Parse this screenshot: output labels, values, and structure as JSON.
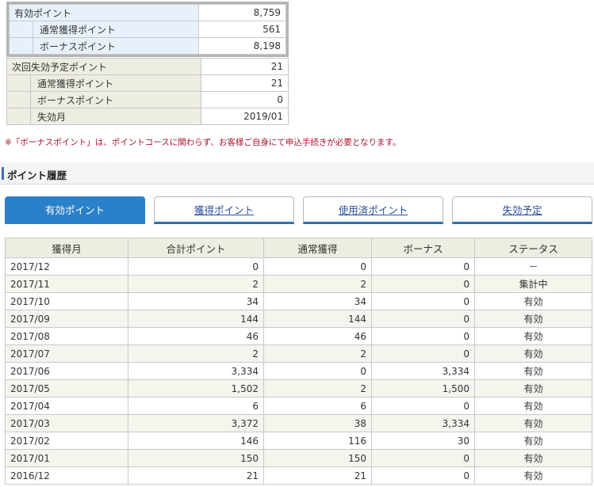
{
  "summary_valid": {
    "total": {
      "label": "有効ポイント",
      "value": "8,759"
    },
    "rows": [
      {
        "label": "通常獲得ポイント",
        "value": "561"
      },
      {
        "label": "ボーナスポイント",
        "value": "8,198"
      }
    ]
  },
  "summary_expire": {
    "total": {
      "label": "次回失効予定ポイント",
      "value": "21"
    },
    "rows": [
      {
        "label": "通常獲得ポイント",
        "value": "21"
      },
      {
        "label": "ボーナスポイント",
        "value": "0"
      },
      {
        "label": "失効月",
        "value": "2019/01"
      }
    ]
  },
  "note": "※「ボーナスポイント」は、ポイントコースに関わらず、お客様ご自身にて申込手続きが必要となります。",
  "section_title": "ポイント履歴",
  "tabs": [
    {
      "label": "有効ポイント",
      "active": true
    },
    {
      "label": "獲得ポイント",
      "active": false
    },
    {
      "label": "使用済ポイント",
      "active": false
    },
    {
      "label": "失効予定",
      "active": false
    }
  ],
  "history": {
    "headers": [
      "獲得月",
      "合計ポイント",
      "通常獲得",
      "ボーナス",
      "ステータス"
    ],
    "rows": [
      [
        "2017/12",
        "0",
        "0",
        "0",
        "－"
      ],
      [
        "2017/11",
        "2",
        "2",
        "0",
        "集計中"
      ],
      [
        "2017/10",
        "34",
        "34",
        "0",
        "有効"
      ],
      [
        "2017/09",
        "144",
        "144",
        "0",
        "有効"
      ],
      [
        "2017/08",
        "46",
        "46",
        "0",
        "有効"
      ],
      [
        "2017/07",
        "2",
        "2",
        "0",
        "有効"
      ],
      [
        "2017/06",
        "3,334",
        "0",
        "3,334",
        "有効"
      ],
      [
        "2017/05",
        "1,502",
        "2",
        "1,500",
        "有効"
      ],
      [
        "2017/04",
        "6",
        "6",
        "0",
        "有効"
      ],
      [
        "2017/03",
        "3,372",
        "38",
        "3,334",
        "有効"
      ],
      [
        "2017/02",
        "146",
        "116",
        "30",
        "有効"
      ],
      [
        "2017/01",
        "150",
        "150",
        "0",
        "有効"
      ],
      [
        "2016/12",
        "21",
        "21",
        "0",
        "有効"
      ]
    ]
  }
}
